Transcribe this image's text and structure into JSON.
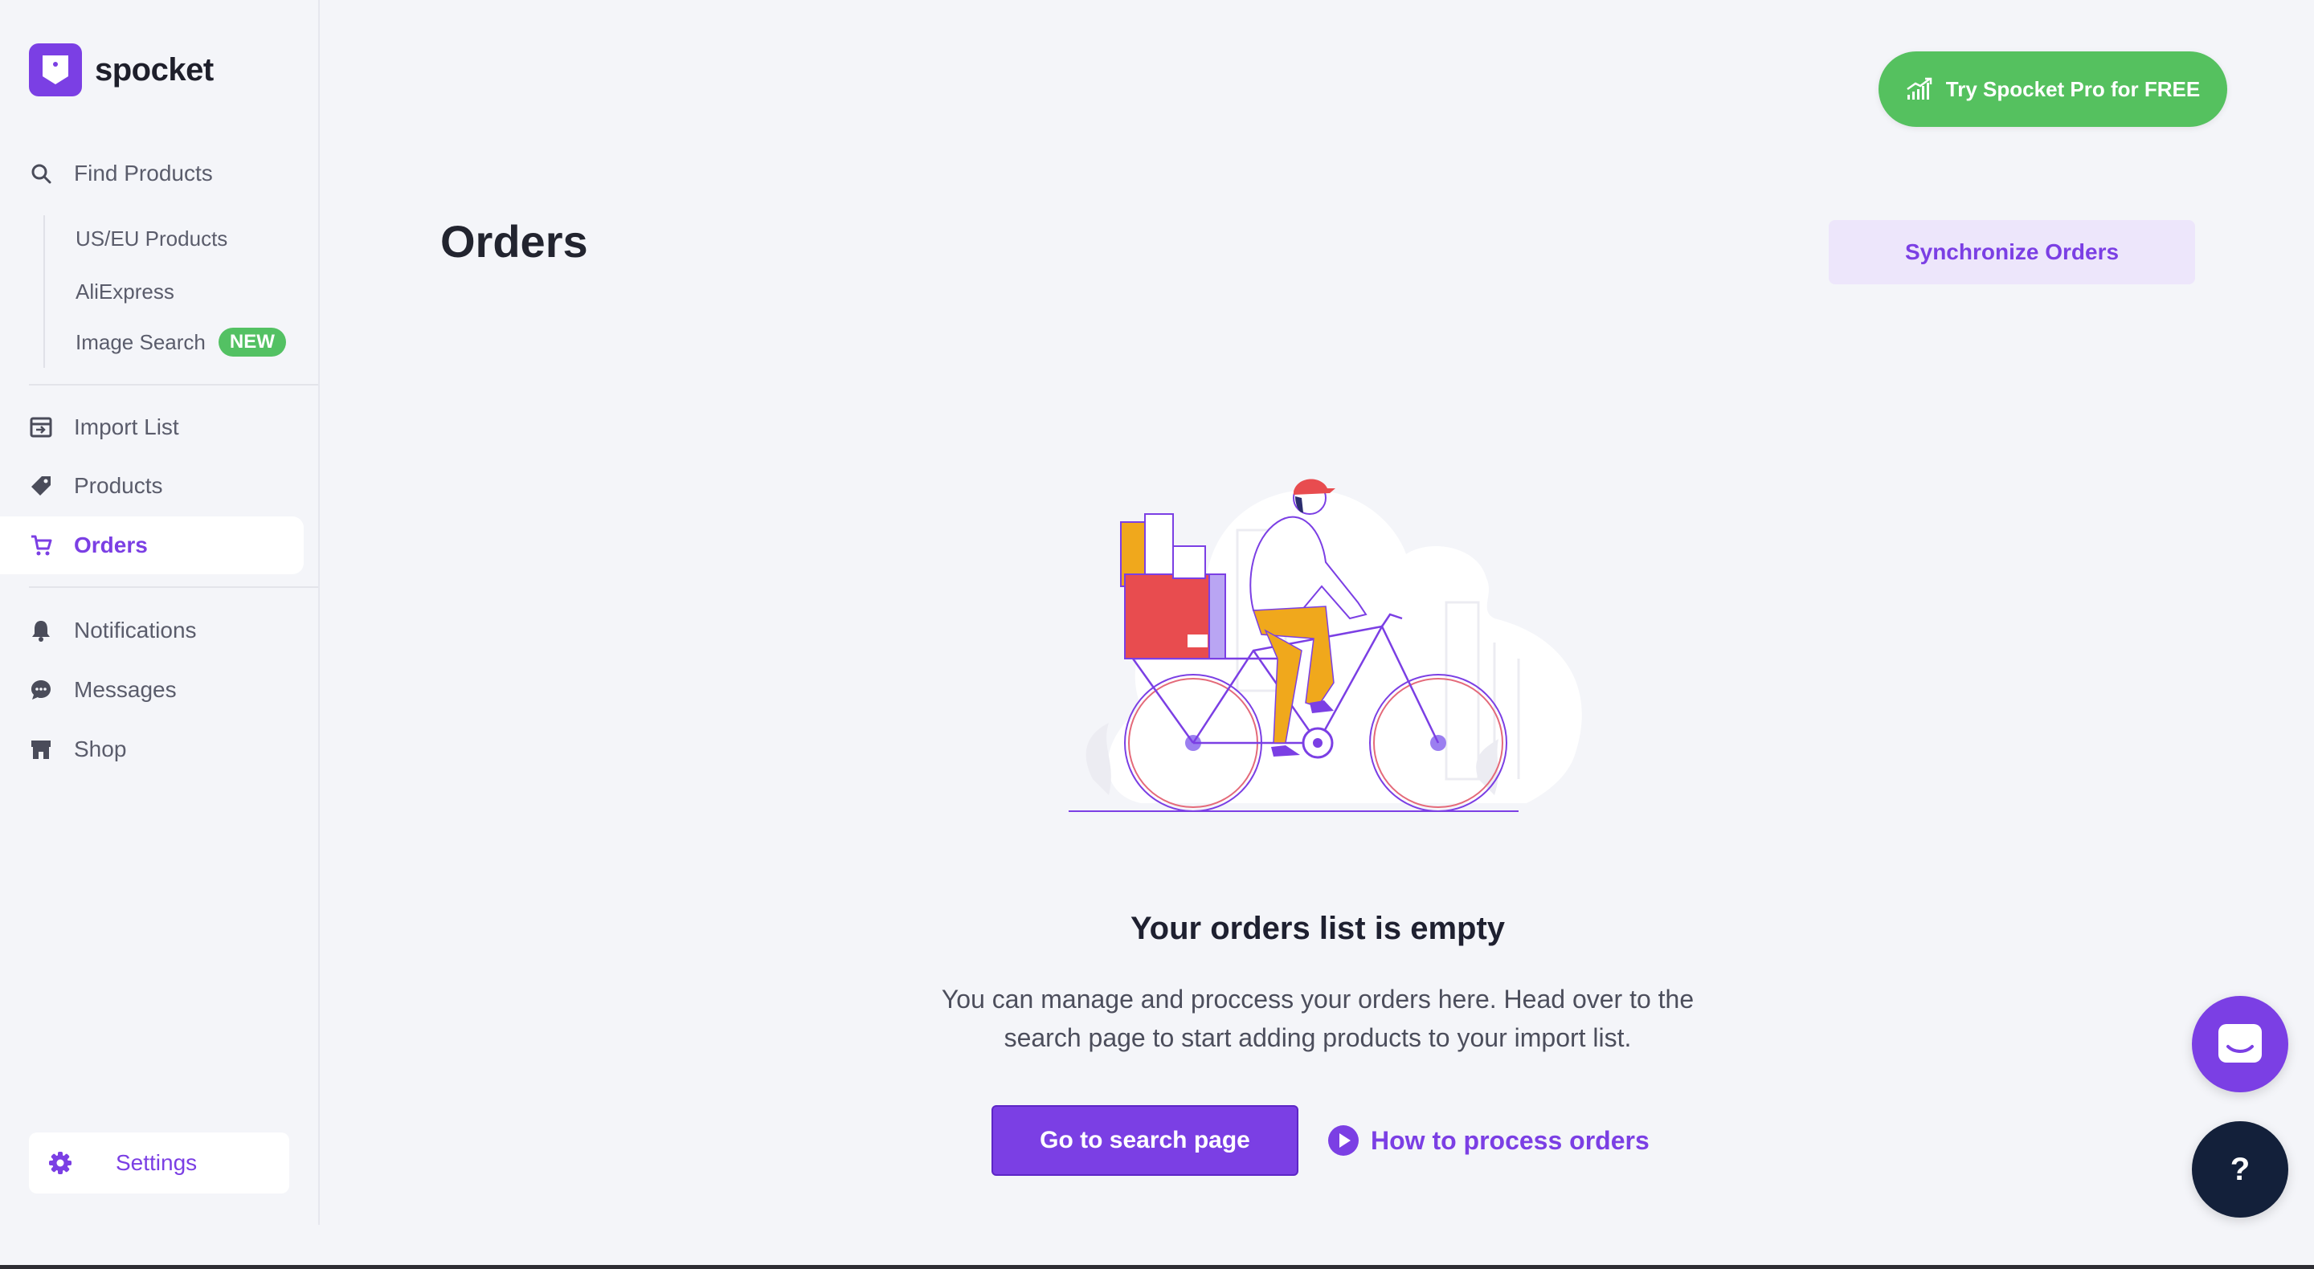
{
  "brand": {
    "name": "spocket",
    "accent": "#7b3fe4",
    "success": "#55c15f"
  },
  "sidebar": {
    "find_products": {
      "label": "Find Products",
      "icon": "search-icon"
    },
    "sub_items": [
      {
        "label": "US/EU Products"
      },
      {
        "label": "AliExpress"
      },
      {
        "label": "Image Search",
        "badge": "NEW"
      }
    ],
    "items": [
      {
        "label": "Import List",
        "icon": "import-list-icon"
      },
      {
        "label": "Products",
        "icon": "tag-icon"
      },
      {
        "label": "Orders",
        "icon": "cart-icon",
        "active": true
      },
      {
        "label": "Notifications",
        "icon": "bell-icon"
      },
      {
        "label": "Messages",
        "icon": "chat-bubble-icon"
      },
      {
        "label": "Shop",
        "icon": "store-icon"
      }
    ],
    "settings": {
      "label": "Settings",
      "icon": "gear-icon"
    }
  },
  "header": {
    "pro_button": "Try Spocket Pro for FREE",
    "page_title": "Orders",
    "sync_button": "Synchronize Orders"
  },
  "empty_state": {
    "title": "Your orders list is empty",
    "line1": "You can manage and proccess your orders here. Head over to the",
    "line2": "search page to start adding products to your import list.",
    "cta": "Go to search page",
    "help_link": "How to process orders"
  },
  "widgets": {
    "help_label": "?"
  }
}
